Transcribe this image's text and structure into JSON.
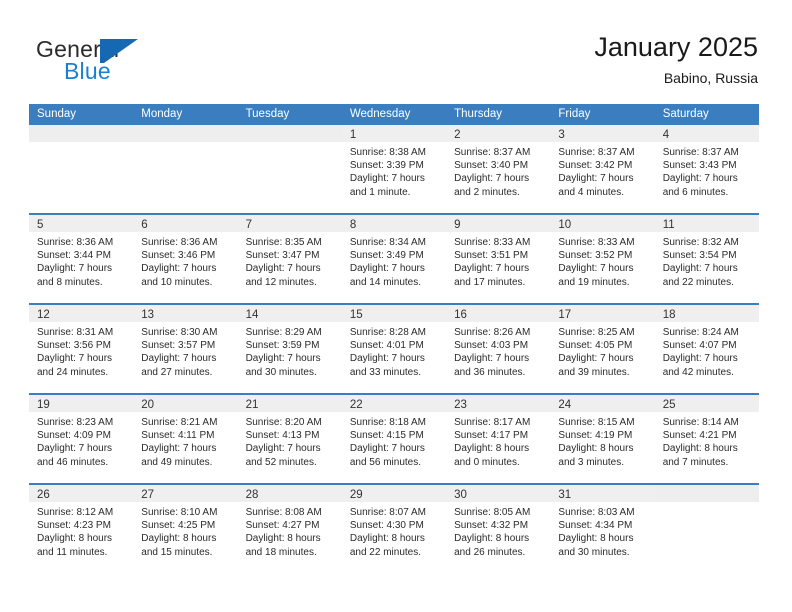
{
  "brand": {
    "name_top": "General",
    "name_bottom": "Blue",
    "accent_color": "#1c7fd0",
    "mark_color": "#1668b3"
  },
  "header": {
    "title": "January 2025",
    "location": "Babino, Russia"
  },
  "calendar": {
    "header_bg": "#3a7ec0",
    "daynum_bg": "#efefef",
    "weekdays": [
      "Sunday",
      "Monday",
      "Tuesday",
      "Wednesday",
      "Thursday",
      "Friday",
      "Saturday"
    ],
    "weeks": [
      [
        {
          "day": "",
          "lines": []
        },
        {
          "day": "",
          "lines": []
        },
        {
          "day": "",
          "lines": []
        },
        {
          "day": "1",
          "lines": [
            "Sunrise: 8:38 AM",
            "Sunset: 3:39 PM",
            "Daylight: 7 hours",
            "and 1 minute."
          ]
        },
        {
          "day": "2",
          "lines": [
            "Sunrise: 8:37 AM",
            "Sunset: 3:40 PM",
            "Daylight: 7 hours",
            "and 2 minutes."
          ]
        },
        {
          "day": "3",
          "lines": [
            "Sunrise: 8:37 AM",
            "Sunset: 3:42 PM",
            "Daylight: 7 hours",
            "and 4 minutes."
          ]
        },
        {
          "day": "4",
          "lines": [
            "Sunrise: 8:37 AM",
            "Sunset: 3:43 PM",
            "Daylight: 7 hours",
            "and 6 minutes."
          ]
        }
      ],
      [
        {
          "day": "5",
          "lines": [
            "Sunrise: 8:36 AM",
            "Sunset: 3:44 PM",
            "Daylight: 7 hours",
            "and 8 minutes."
          ]
        },
        {
          "day": "6",
          "lines": [
            "Sunrise: 8:36 AM",
            "Sunset: 3:46 PM",
            "Daylight: 7 hours",
            "and 10 minutes."
          ]
        },
        {
          "day": "7",
          "lines": [
            "Sunrise: 8:35 AM",
            "Sunset: 3:47 PM",
            "Daylight: 7 hours",
            "and 12 minutes."
          ]
        },
        {
          "day": "8",
          "lines": [
            "Sunrise: 8:34 AM",
            "Sunset: 3:49 PM",
            "Daylight: 7 hours",
            "and 14 minutes."
          ]
        },
        {
          "day": "9",
          "lines": [
            "Sunrise: 8:33 AM",
            "Sunset: 3:51 PM",
            "Daylight: 7 hours",
            "and 17 minutes."
          ]
        },
        {
          "day": "10",
          "lines": [
            "Sunrise: 8:33 AM",
            "Sunset: 3:52 PM",
            "Daylight: 7 hours",
            "and 19 minutes."
          ]
        },
        {
          "day": "11",
          "lines": [
            "Sunrise: 8:32 AM",
            "Sunset: 3:54 PM",
            "Daylight: 7 hours",
            "and 22 minutes."
          ]
        }
      ],
      [
        {
          "day": "12",
          "lines": [
            "Sunrise: 8:31 AM",
            "Sunset: 3:56 PM",
            "Daylight: 7 hours",
            "and 24 minutes."
          ]
        },
        {
          "day": "13",
          "lines": [
            "Sunrise: 8:30 AM",
            "Sunset: 3:57 PM",
            "Daylight: 7 hours",
            "and 27 minutes."
          ]
        },
        {
          "day": "14",
          "lines": [
            "Sunrise: 8:29 AM",
            "Sunset: 3:59 PM",
            "Daylight: 7 hours",
            "and 30 minutes."
          ]
        },
        {
          "day": "15",
          "lines": [
            "Sunrise: 8:28 AM",
            "Sunset: 4:01 PM",
            "Daylight: 7 hours",
            "and 33 minutes."
          ]
        },
        {
          "day": "16",
          "lines": [
            "Sunrise: 8:26 AM",
            "Sunset: 4:03 PM",
            "Daylight: 7 hours",
            "and 36 minutes."
          ]
        },
        {
          "day": "17",
          "lines": [
            "Sunrise: 8:25 AM",
            "Sunset: 4:05 PM",
            "Daylight: 7 hours",
            "and 39 minutes."
          ]
        },
        {
          "day": "18",
          "lines": [
            "Sunrise: 8:24 AM",
            "Sunset: 4:07 PM",
            "Daylight: 7 hours",
            "and 42 minutes."
          ]
        }
      ],
      [
        {
          "day": "19",
          "lines": [
            "Sunrise: 8:23 AM",
            "Sunset: 4:09 PM",
            "Daylight: 7 hours",
            "and 46 minutes."
          ]
        },
        {
          "day": "20",
          "lines": [
            "Sunrise: 8:21 AM",
            "Sunset: 4:11 PM",
            "Daylight: 7 hours",
            "and 49 minutes."
          ]
        },
        {
          "day": "21",
          "lines": [
            "Sunrise: 8:20 AM",
            "Sunset: 4:13 PM",
            "Daylight: 7 hours",
            "and 52 minutes."
          ]
        },
        {
          "day": "22",
          "lines": [
            "Sunrise: 8:18 AM",
            "Sunset: 4:15 PM",
            "Daylight: 7 hours",
            "and 56 minutes."
          ]
        },
        {
          "day": "23",
          "lines": [
            "Sunrise: 8:17 AM",
            "Sunset: 4:17 PM",
            "Daylight: 8 hours",
            "and 0 minutes."
          ]
        },
        {
          "day": "24",
          "lines": [
            "Sunrise: 8:15 AM",
            "Sunset: 4:19 PM",
            "Daylight: 8 hours",
            "and 3 minutes."
          ]
        },
        {
          "day": "25",
          "lines": [
            "Sunrise: 8:14 AM",
            "Sunset: 4:21 PM",
            "Daylight: 8 hours",
            "and 7 minutes."
          ]
        }
      ],
      [
        {
          "day": "26",
          "lines": [
            "Sunrise: 8:12 AM",
            "Sunset: 4:23 PM",
            "Daylight: 8 hours",
            "and 11 minutes."
          ]
        },
        {
          "day": "27",
          "lines": [
            "Sunrise: 8:10 AM",
            "Sunset: 4:25 PM",
            "Daylight: 8 hours",
            "and 15 minutes."
          ]
        },
        {
          "day": "28",
          "lines": [
            "Sunrise: 8:08 AM",
            "Sunset: 4:27 PM",
            "Daylight: 8 hours",
            "and 18 minutes."
          ]
        },
        {
          "day": "29",
          "lines": [
            "Sunrise: 8:07 AM",
            "Sunset: 4:30 PM",
            "Daylight: 8 hours",
            "and 22 minutes."
          ]
        },
        {
          "day": "30",
          "lines": [
            "Sunrise: 8:05 AM",
            "Sunset: 4:32 PM",
            "Daylight: 8 hours",
            "and 26 minutes."
          ]
        },
        {
          "day": "31",
          "lines": [
            "Sunrise: 8:03 AM",
            "Sunset: 4:34 PM",
            "Daylight: 8 hours",
            "and 30 minutes."
          ]
        },
        {
          "day": "",
          "lines": []
        }
      ]
    ]
  }
}
